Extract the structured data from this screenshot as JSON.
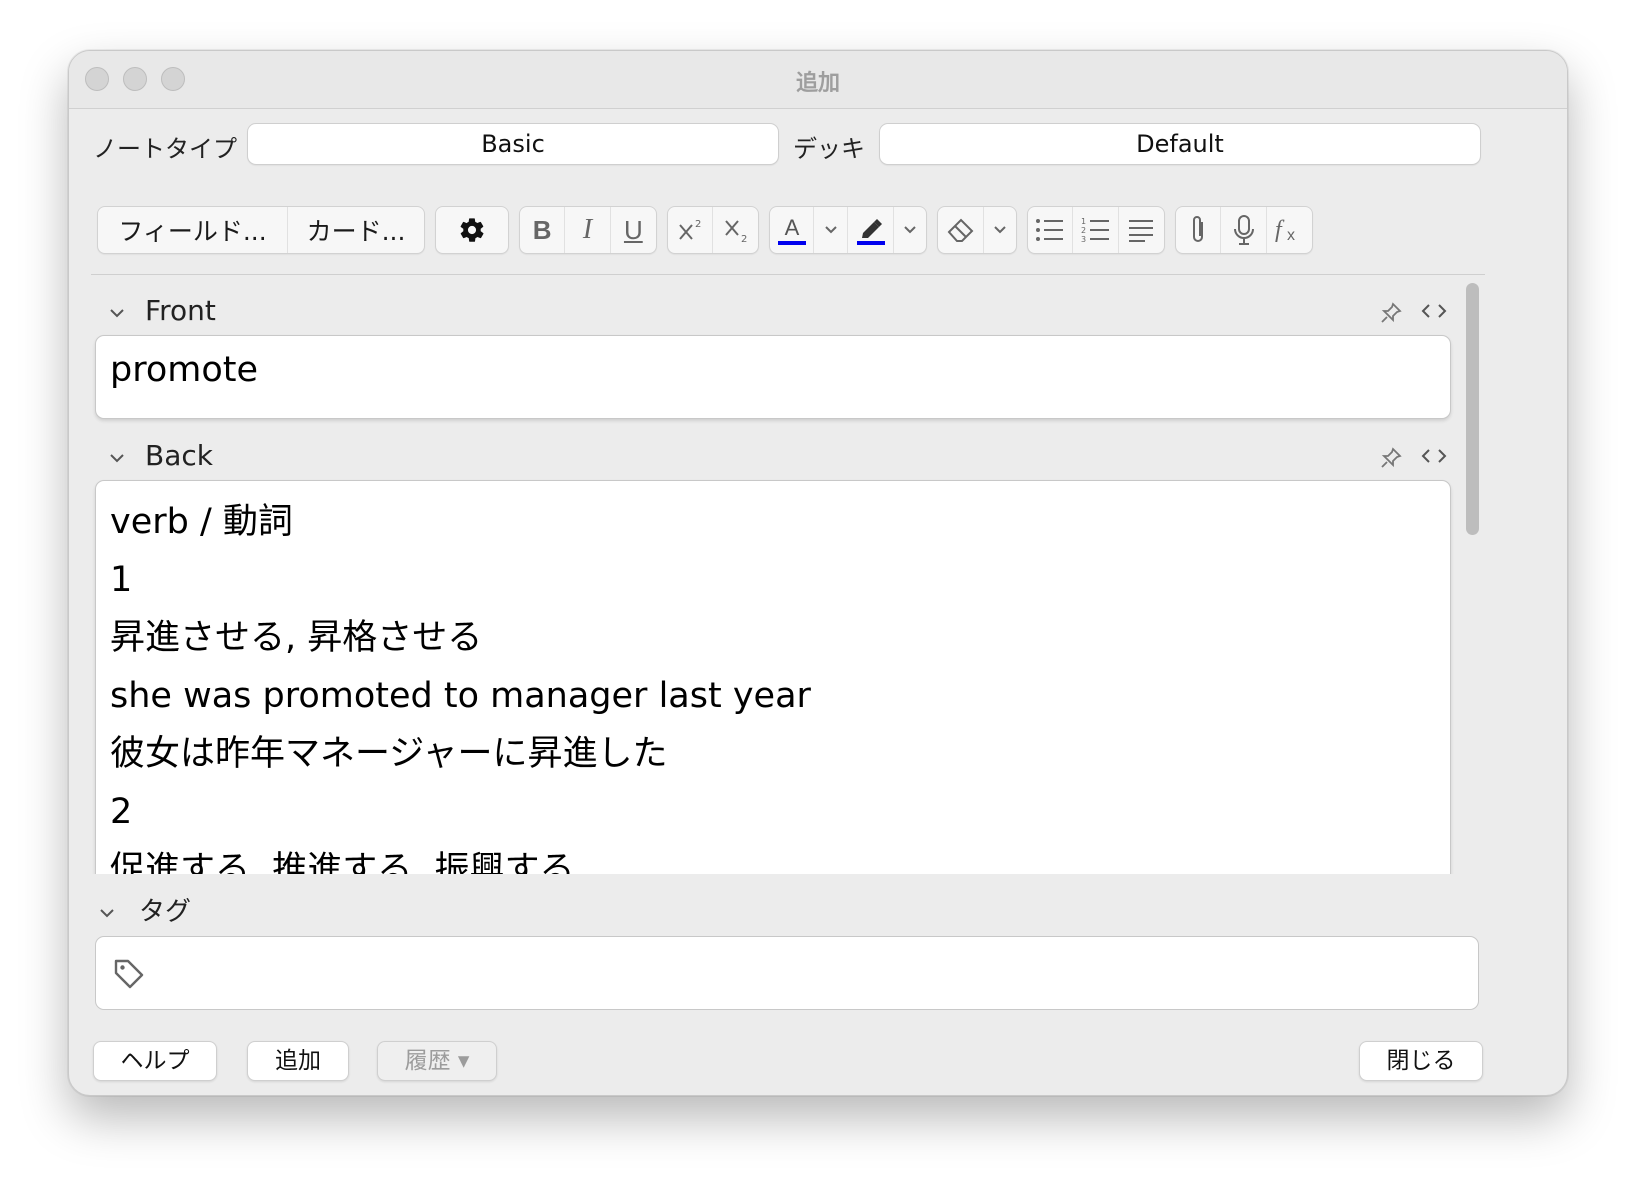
{
  "window": {
    "title": "追加"
  },
  "top": {
    "notetype_label": "ノートタイプ",
    "notetype_value": "Basic",
    "deck_label": "デッキ",
    "deck_value": "Default"
  },
  "toolbar": {
    "fields_button": "フィールド...",
    "cards_button": "カード...",
    "bold_label": "B",
    "italic_label": "I",
    "underline_label": "U",
    "text_color": "#0000ee",
    "highlight_color": "#0000ee",
    "icons": [
      "gear-icon",
      "superscript-icon",
      "subscript-icon",
      "text-color-icon",
      "highlight-icon",
      "eraser-icon",
      "bullet-list-icon",
      "numbered-list-icon",
      "align-icon",
      "paperclip-icon",
      "microphone-icon",
      "function-icon"
    ]
  },
  "fields": {
    "front": {
      "name": "Front",
      "value": "promote"
    },
    "back": {
      "name": "Back",
      "lines": [
        "verb / 動詞",
        "1",
        "昇進させる, 昇格させる",
        "she was promoted to manager last year",
        "彼女は昨年マネージャーに昇進した",
        "2",
        "促進する, 推進する, 振興する"
      ]
    }
  },
  "tags": {
    "label": "タグ"
  },
  "buttons": {
    "help": "ヘルプ",
    "add": "追加",
    "history": "履歴 ▾",
    "close": "閉じる"
  }
}
